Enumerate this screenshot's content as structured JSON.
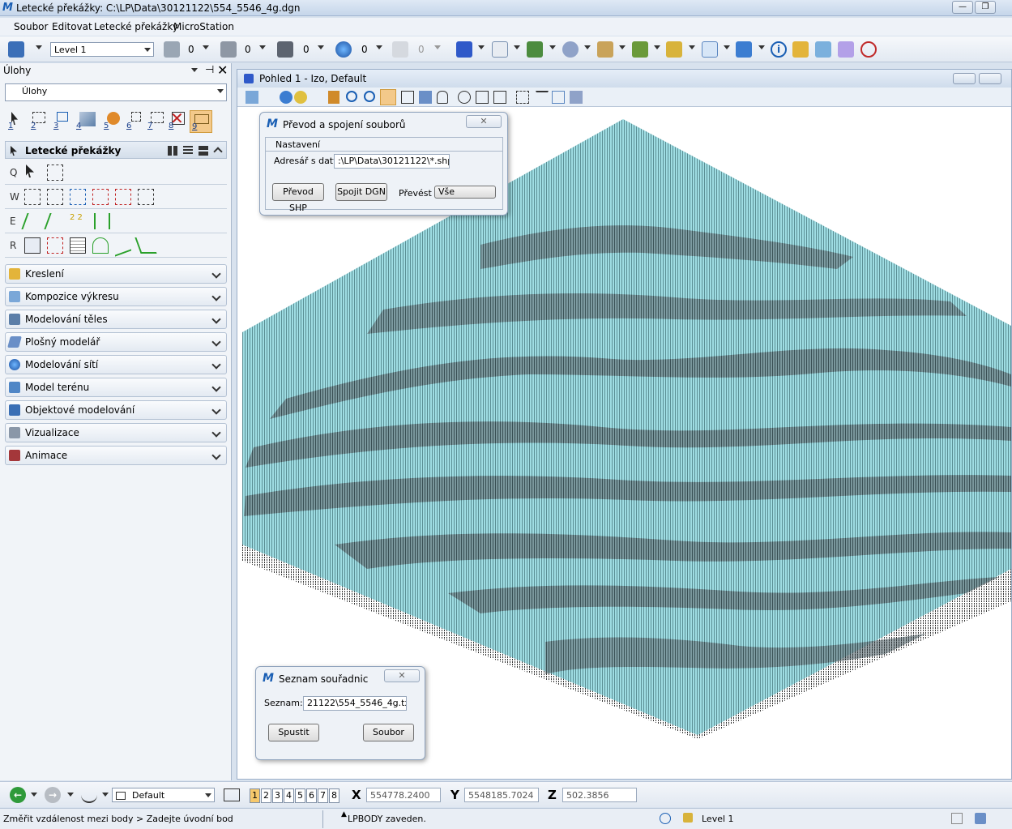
{
  "app": {
    "title": "Letecké překážky:  C:\\LP\\Data\\30121122\\554_5546_4g.dgn",
    "window_buttons": [
      "—",
      "❐",
      "✕"
    ]
  },
  "menu": [
    "Soubor",
    "Editovat",
    "Letecké překážky",
    "MicroStation"
  ],
  "toolbar": {
    "level": "Level 1",
    "counters": [
      "0",
      "0",
      "0",
      "0",
      "0"
    ]
  },
  "left_panel": {
    "header": "Úlohy",
    "task_combo": "Úlohy",
    "numbered_tools": [
      "1",
      "2",
      "3",
      "4",
      "5",
      "6",
      "7",
      "8",
      "9"
    ],
    "section_title": "Letecké překážky",
    "row_keys": [
      "Q",
      "W",
      "E",
      "R"
    ],
    "tasks": [
      "Kreslení",
      "Kompozice výkresu",
      "Modelování těles",
      "Plošný modelář",
      "Modelování sítí",
      "Model terénu",
      "Objektové modelování",
      "Vizualizace",
      "Animace"
    ]
  },
  "view": {
    "title": "Pohled 1 - Izo, Default"
  },
  "dialog_prevod": {
    "title": "Převod a spojení souborů",
    "group": "Nastavení",
    "path_label": "Adresář s daty",
    "path_value": ":\\LP\\Data\\30121122\\*.shp",
    "btn_shp": "Převod SHP",
    "btn_dgn": "Spojit DGN",
    "convert_label": "Převést",
    "convert_value": "Vše"
  },
  "dialog_seznam": {
    "title": "Seznam souřadnic",
    "list_label": "Seznam:",
    "list_value": "21122\\554_5546_4g.txt",
    "btn_run": "Spustit",
    "btn_file": "Soubor"
  },
  "bottom": {
    "view_set": "Default",
    "view_numbers": [
      "1",
      "2",
      "3",
      "4",
      "5",
      "6",
      "7",
      "8"
    ],
    "x_label": "X",
    "x_value": "554778.2400",
    "y_label": "Y",
    "y_value": "5548185.7024",
    "z_label": "Z",
    "z_value": "502.3856"
  },
  "status": {
    "prompt": "Změřit vzdálenost mezi body > Zadejte úvodní bod",
    "message": "LPBODY zaveden.",
    "level": "Level 1"
  },
  "colors": {
    "terrain": "#8fd8df",
    "terrain_dark": "#3d4d52",
    "accent": "#1a5fb4"
  }
}
